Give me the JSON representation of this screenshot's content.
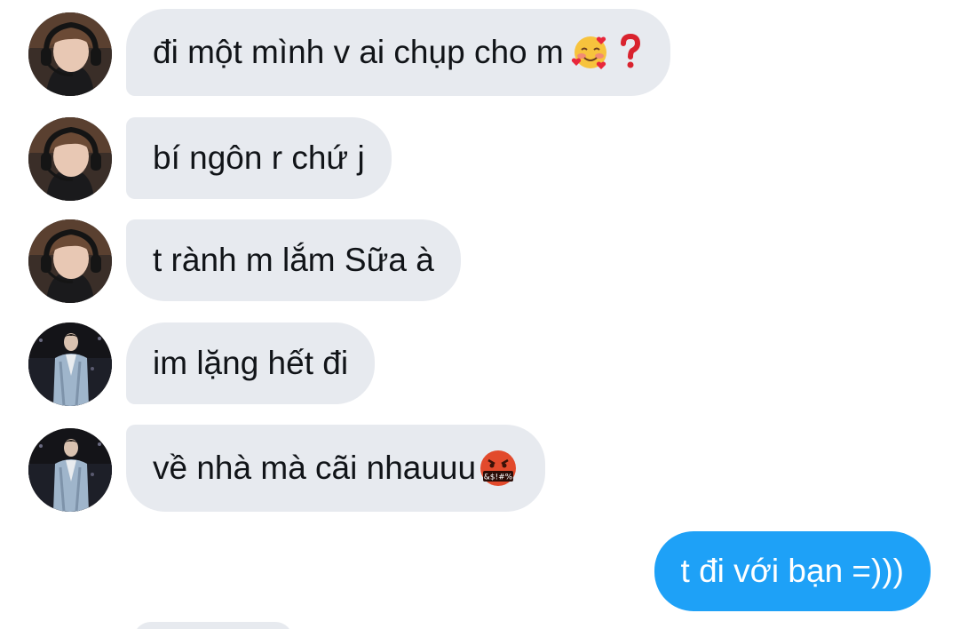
{
  "messages": [
    {
      "sender": "friend_a",
      "text": "đi một mình v ai chụp cho m",
      "emoji": [
        "smiling-face-with-hearts",
        "red-question-mark"
      ]
    },
    {
      "sender": "friend_a",
      "text": "bí ngôn r chứ j",
      "emoji": []
    },
    {
      "sender": "friend_a",
      "text": "t rành m lắm Sữa à",
      "emoji": []
    },
    {
      "sender": "friend_b",
      "text": "im lặng hết đi",
      "emoji": []
    },
    {
      "sender": "friend_b",
      "text": "về nhà mà cãi nhauuu",
      "emoji": [
        "face-with-symbols-on-mouth"
      ],
      "emoji_text": "&$!#%"
    },
    {
      "sender": "me",
      "text": "t đi với bạn =)))",
      "emoji": []
    }
  ],
  "colors": {
    "incoming_bubble": "#e7eaef",
    "outgoing_bubble": "#1ea1f7",
    "incoming_text": "#111418",
    "outgoing_text": "#ffffff"
  }
}
